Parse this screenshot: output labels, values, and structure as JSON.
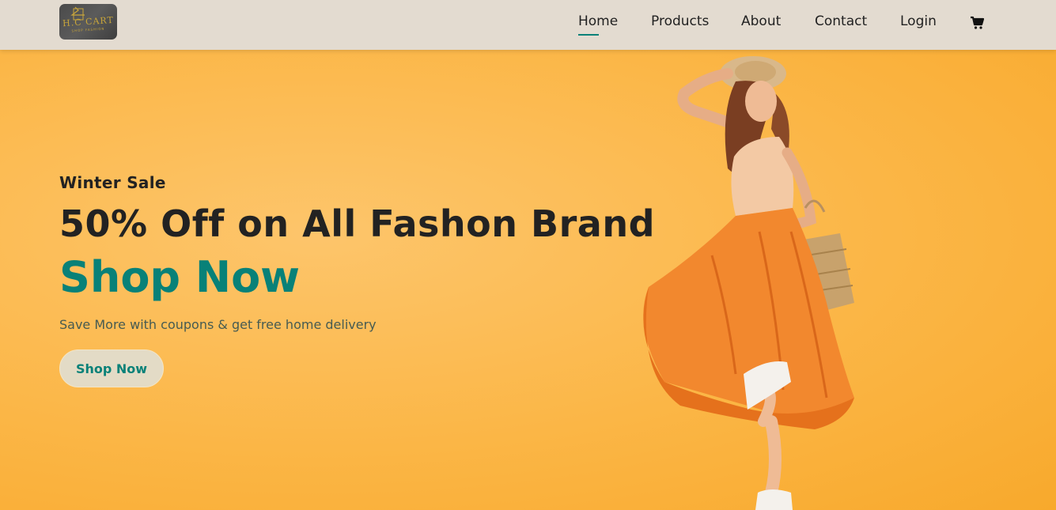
{
  "brand": {
    "logo_text": "H.C CART",
    "logo_subtext": "SHOP FASHION",
    "logo_name": "hanger-logo"
  },
  "nav": {
    "items": [
      {
        "label": "Home",
        "active": true
      },
      {
        "label": "Products",
        "active": false
      },
      {
        "label": "About",
        "active": false
      },
      {
        "label": "Contact",
        "active": false
      },
      {
        "label": "Login",
        "active": false
      }
    ],
    "cart_icon": "shopping-cart-icon"
  },
  "hero": {
    "subtitle": "Winter Sale",
    "title": "50% Off on All Fashon Brand",
    "accent": "Shop Now",
    "description": "Save More with coupons & get free home delivery",
    "button_label": "Shop Now"
  },
  "colors": {
    "nav_bg": "#e3dbd0",
    "hero_bg": "#fbb646",
    "accent": "#088178",
    "button_bg": "#e3dbc6"
  }
}
